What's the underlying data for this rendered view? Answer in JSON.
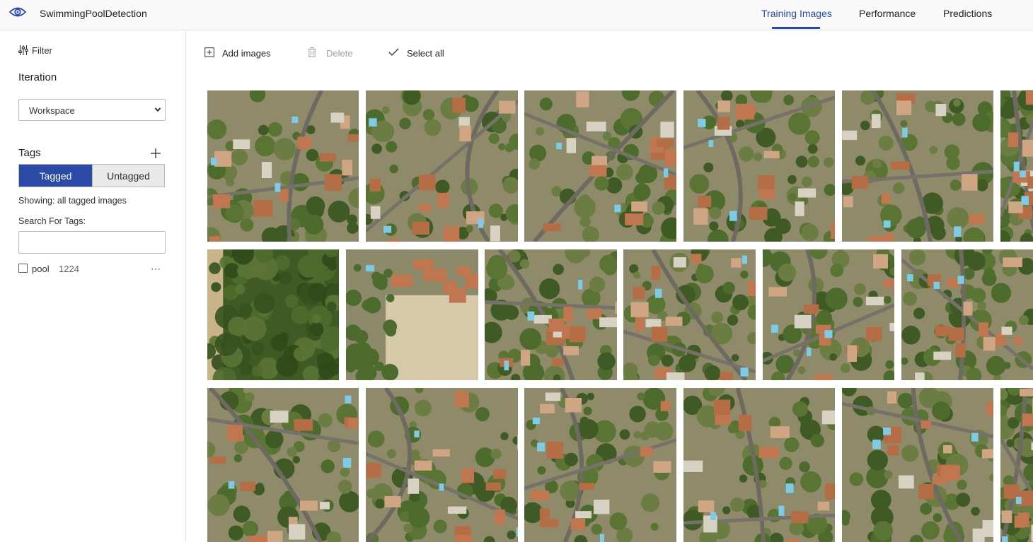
{
  "app": {
    "title": "SwimmingPoolDetection"
  },
  "nav": {
    "tabs": [
      {
        "label": "Training Images",
        "active": true
      },
      {
        "label": "Performance",
        "active": false
      },
      {
        "label": "Predictions",
        "active": false
      }
    ]
  },
  "sidebar": {
    "filter_label": "Filter",
    "iteration_heading": "Iteration",
    "iteration_selected": "Workspace",
    "tags_heading": "Tags",
    "toggle": {
      "tagged": "Tagged",
      "untagged": "Untagged",
      "selected": "Tagged"
    },
    "showing_text": "Showing: all tagged images",
    "search_label": "Search For Tags:",
    "search_value": "",
    "tags": [
      {
        "name": "pool",
        "count": "1224",
        "checked": false
      }
    ]
  },
  "toolbar": {
    "add_images": "Add images",
    "delete": "Delete",
    "select_all": "Select all"
  },
  "gallery": {
    "rows": [
      {
        "images": [
          "aerial residential",
          "aerial residential",
          "aerial residential",
          "aerial residential",
          "aerial residential",
          "aerial residential"
        ]
      },
      {
        "images": [
          "aerial forest",
          "aerial field",
          "aerial residential",
          "aerial residential",
          "aerial residential",
          "aerial residential"
        ]
      },
      {
        "images": [
          "aerial residential",
          "aerial residential",
          "aerial residential",
          "aerial residential",
          "aerial residential",
          "aerial residential"
        ]
      }
    ]
  },
  "colors": {
    "accent": "#2b4aa6",
    "header_bg": "#f9f9f9",
    "disabled_text": "#a19f9d",
    "pool": "#7ecbe6",
    "vegetation": "#4d6b2c",
    "roof": "#c0764e"
  }
}
